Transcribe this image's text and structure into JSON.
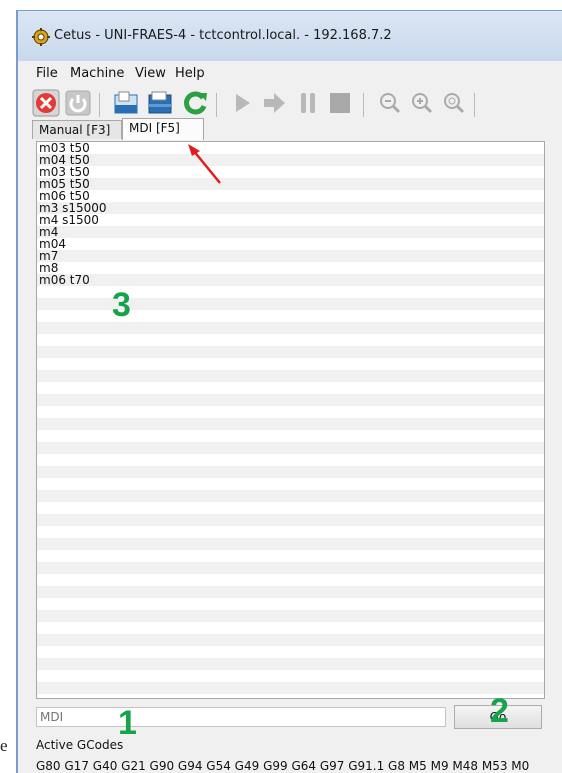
{
  "window": {
    "title": "Cetus - UNI-FRAES-4 - tctcontrol.local. - 192.168.7.2"
  },
  "menu": [
    "File",
    "Machine",
    "View",
    "Help"
  ],
  "toolbar": {
    "icons": [
      "stop-icon",
      "power-icon",
      "open-file-icon",
      "open-file-alt-icon",
      "refresh-icon",
      "play-icon",
      "step-icon",
      "pause-icon",
      "stop-square-icon",
      "zoom-out-icon",
      "zoom-in-icon",
      "zoom-fit-icon"
    ],
    "colors": {
      "stop": "#e23a36",
      "refresh": "#2ea043",
      "disabled": "#b8b8b8",
      "file": "#2a6fb3"
    }
  },
  "tabs": [
    {
      "label": "Manual [F3]",
      "active": false
    },
    {
      "label": "MDI [F5]",
      "active": true
    }
  ],
  "history": [
    "m03 t50",
    "m04 t50",
    "m03 t50",
    "m05 t50",
    "m06 t50",
    "m3 s15000",
    "m4 s1500",
    "m4",
    "m04",
    "m7",
    "m8",
    "m06 t70"
  ],
  "mdi_input": {
    "placeholder": "MDI",
    "value": ""
  },
  "go_button": {
    "label": "Go"
  },
  "active_gcodes": {
    "label": "Active GCodes",
    "value": "G80 G17 G40 G21 G90 G94 G54 G49 G99 G64 G97 G91.1 G8 M5 M9 M48 M53 M0"
  },
  "annotations": {
    "one": "1",
    "two": "2",
    "three": "3",
    "color": "#17a34a",
    "arrow_color": "#e11d1d"
  },
  "stray_text": "e"
}
